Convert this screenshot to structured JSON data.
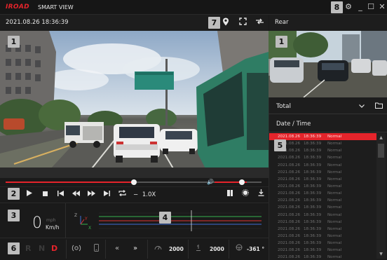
{
  "window": {
    "logo": "IROAD",
    "app_name": "SMART VIEW",
    "settings_icon": "gear-icon",
    "minimize_icon": "minimize-icon",
    "maximize_icon": "maximize-icon",
    "close_icon": "close-icon"
  },
  "badges": {
    "b1": "1",
    "b2": "2",
    "b3": "3",
    "b4": "4",
    "b5": "5",
    "b6": "6",
    "b7": "7",
    "b8": "8",
    "b1r": "1"
  },
  "main_header": {
    "datetime": "2021.08.26 18:36:39",
    "map_icon": "map-pin-icon",
    "fullscreen_icon": "fullscreen-icon",
    "swap_icon": "swap-icon"
  },
  "rear_header": {
    "title": "Rear"
  },
  "playback": {
    "progress": 0.5,
    "volume": 0.85,
    "speed_label": "1.0X",
    "speed_minus": "−",
    "speed_plus": "+",
    "buttons": [
      "play-icon",
      "stop-icon",
      "skip-start-icon",
      "rewind-icon",
      "fast-forward-icon",
      "skip-end-icon",
      "repeat-icon",
      "split-icon",
      "brightness-icon",
      "download-icon",
      "volume-icon"
    ]
  },
  "sensor": {
    "speed_value": "0",
    "speed_unit_small": "mph",
    "speed_unit": "Km/h",
    "axis_x": "X",
    "axis_y": "Y",
    "axis_z": "Z"
  },
  "status": {
    "gear_r": "R",
    "gear_n": "N",
    "gear_d": "D",
    "rpm": "2000",
    "temp": "2000",
    "angle": "-361 °"
  },
  "file_list": {
    "filter": "Total",
    "header": "Date / Time",
    "rows": [
      {
        "date": "2021.08.26",
        "time": "18:36:39",
        "type": "Normal",
        "selected": true
      },
      {
        "date": "2021.08.26",
        "time": "18:36:39",
        "type": "Normal"
      },
      {
        "date": "2021.08.26",
        "time": "18:36:39",
        "type": "Normal"
      },
      {
        "date": "2021.08.26",
        "time": "18:36:39",
        "type": "Normal"
      },
      {
        "date": "2021.08.26",
        "time": "18:36:39",
        "type": "Normal"
      },
      {
        "date": "2021.08.26",
        "time": "18:36:39",
        "type": "Normal"
      },
      {
        "date": "2021.08.26",
        "time": "18:36:39",
        "type": "Normal"
      },
      {
        "date": "2021.08.26",
        "time": "18:36:39",
        "type": "Normal"
      },
      {
        "date": "2021.08.26",
        "time": "18:36:39",
        "type": "Normal"
      },
      {
        "date": "2021.08.26",
        "time": "18:36:39",
        "type": "Normal"
      },
      {
        "date": "2021.08.26",
        "time": "18:36:39",
        "type": "Normal"
      },
      {
        "date": "2021.08.26",
        "time": "18:36:39",
        "type": "Normal"
      },
      {
        "date": "2021.08.26",
        "time": "18:36:39",
        "type": "Normal"
      },
      {
        "date": "2021.08.26",
        "time": "18:36:39",
        "type": "Normal"
      },
      {
        "date": "2021.08.26",
        "time": "18:36:39",
        "type": "Normal"
      },
      {
        "date": "2021.08.26",
        "time": "18:36:39",
        "type": "Normal"
      },
      {
        "date": "2021.08.26",
        "time": "18:36:39",
        "type": "Normal"
      },
      {
        "date": "2021.08.26",
        "time": "18:36:39",
        "type": "Normal"
      }
    ]
  },
  "colors": {
    "accent": "#e5242b",
    "background": "#1a1a1a",
    "badge": "#bdbdbd"
  }
}
